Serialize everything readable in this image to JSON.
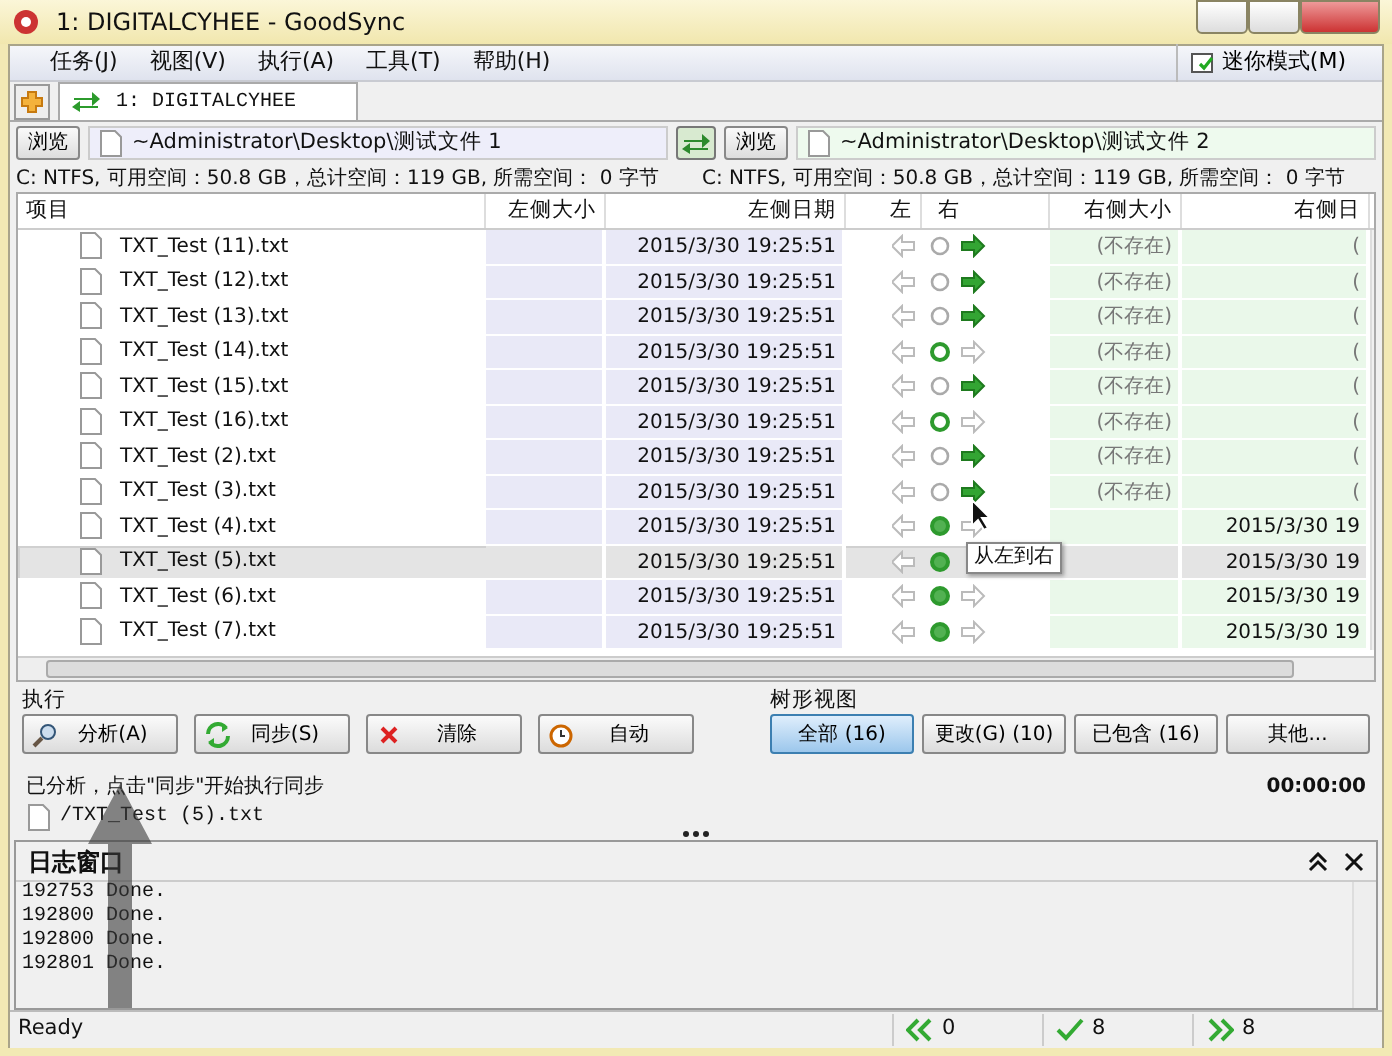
{
  "window": {
    "title": "1: DIGITALCYHEE - GoodSync"
  },
  "menu": [
    "任务(J)",
    "视图(V)",
    "执行(A)",
    "工具(T)",
    "帮助(H)"
  ],
  "mini_mode_button": "迷你模式(M)",
  "tabs": [
    {
      "label": "1: DIGITALCYHEE",
      "selected": true
    }
  ],
  "left_folder": {
    "browse": "浏览",
    "path": "~Administrator\\Desktop\\测试文件 1",
    "info": "C: NTFS, 可用空间：50.8 GB，总计空间：119 GB, 所需空间： 0 字节"
  },
  "right_folder": {
    "browse": "浏览",
    "path": "~Administrator\\Desktop\\测试文件 2",
    "info": "C: NTFS, 可用空间：50.8 GB，总计空间：119 GB, 所需空间： 0 字节"
  },
  "table": {
    "columns": [
      "项目",
      "左侧大小",
      "左侧日期",
      "左",
      "右",
      "右侧大小",
      "右侧日"
    ],
    "rows": [
      {
        "name": "TXT_Test (11).txt",
        "left_date": "2015/3/30 19:25:51",
        "circle_green": false,
        "circle_filled": false,
        "copy_right": true,
        "right_size": "(不存在)",
        "right_date": "(",
        "selected": false
      },
      {
        "name": "TXT_Test (12).txt",
        "left_date": "2015/3/30 19:25:51",
        "circle_green": false,
        "circle_filled": false,
        "copy_right": true,
        "right_size": "(不存在)",
        "right_date": "(",
        "selected": false
      },
      {
        "name": "TXT_Test (13).txt",
        "left_date": "2015/3/30 19:25:51",
        "circle_green": false,
        "circle_filled": false,
        "copy_right": true,
        "right_size": "(不存在)",
        "right_date": "(",
        "selected": false
      },
      {
        "name": "TXT_Test (14).txt",
        "left_date": "2015/3/30 19:25:51",
        "circle_green": true,
        "circle_filled": false,
        "copy_right": false,
        "right_size": "(不存在)",
        "right_date": "(",
        "selected": false
      },
      {
        "name": "TXT_Test (15).txt",
        "left_date": "2015/3/30 19:25:51",
        "circle_green": false,
        "circle_filled": false,
        "copy_right": true,
        "right_size": "(不存在)",
        "right_date": "(",
        "selected": false
      },
      {
        "name": "TXT_Test (16).txt",
        "left_date": "2015/3/30 19:25:51",
        "circle_green": true,
        "circle_filled": false,
        "copy_right": false,
        "right_size": "(不存在)",
        "right_date": "(",
        "selected": false
      },
      {
        "name": "TXT_Test (2).txt",
        "left_date": "2015/3/30 19:25:51",
        "circle_green": false,
        "circle_filled": false,
        "copy_right": true,
        "right_size": "(不存在)",
        "right_date": "(",
        "selected": false
      },
      {
        "name": "TXT_Test (3).txt",
        "left_date": "2015/3/30 19:25:51",
        "circle_green": false,
        "circle_filled": false,
        "copy_right": true,
        "right_size": "(不存在)",
        "right_date": "(",
        "selected": false
      },
      {
        "name": "TXT_Test (4).txt",
        "left_date": "2015/3/30 19:25:51",
        "circle_green": true,
        "circle_filled": true,
        "copy_right": false,
        "right_date": "2015/3/30 19",
        "selected": false
      },
      {
        "name": "TXT_Test (5).txt",
        "left_date": "2015/3/30 19:25:51",
        "circle_green": true,
        "circle_filled": true,
        "right_date": "2015/3/30 19",
        "selected": true
      },
      {
        "name": "TXT_Test (6).txt",
        "left_date": "2015/3/30 19:25:51",
        "circle_green": true,
        "circle_filled": true,
        "copy_right": false,
        "right_date": "2015/3/30 19",
        "selected": false
      },
      {
        "name": "TXT_Test (7).txt",
        "left_date": "2015/3/30 19:25:51",
        "circle_green": true,
        "circle_filled": true,
        "copy_right": false,
        "right_date": "2015/3/30 19",
        "selected": false
      }
    ]
  },
  "tooltip": "从左到右",
  "action_panel": {
    "title": "执行",
    "buttons": [
      {
        "label": "分析(A)",
        "kind": "analyze"
      },
      {
        "label": "同步(S)",
        "kind": "sync"
      },
      {
        "label": "清除",
        "kind": "clear"
      },
      {
        "label": "自动",
        "kind": "auto"
      }
    ]
  },
  "tree_view": {
    "title": "树形视图",
    "filters": [
      {
        "label": "全部 (16)",
        "selected": true
      },
      {
        "label": "更改(G) (10)",
        "selected": false
      },
      {
        "label": "已包含 (16)",
        "selected": false
      },
      {
        "label": "其他...",
        "selected": false
      }
    ]
  },
  "status": {
    "message": "已分析，点击\"同步\"开始执行同步",
    "file": "/TXT_Test (5).txt",
    "elapsed": "00:00:00"
  },
  "log": {
    "title": "日志窗口",
    "lines": [
      "192753 Done.",
      "192800 Done.",
      "192800 Done.",
      "192801 Done."
    ]
  },
  "status_bar": {
    "text": "Ready",
    "left_count": "0",
    "same_count": "8",
    "right_count": "8"
  }
}
